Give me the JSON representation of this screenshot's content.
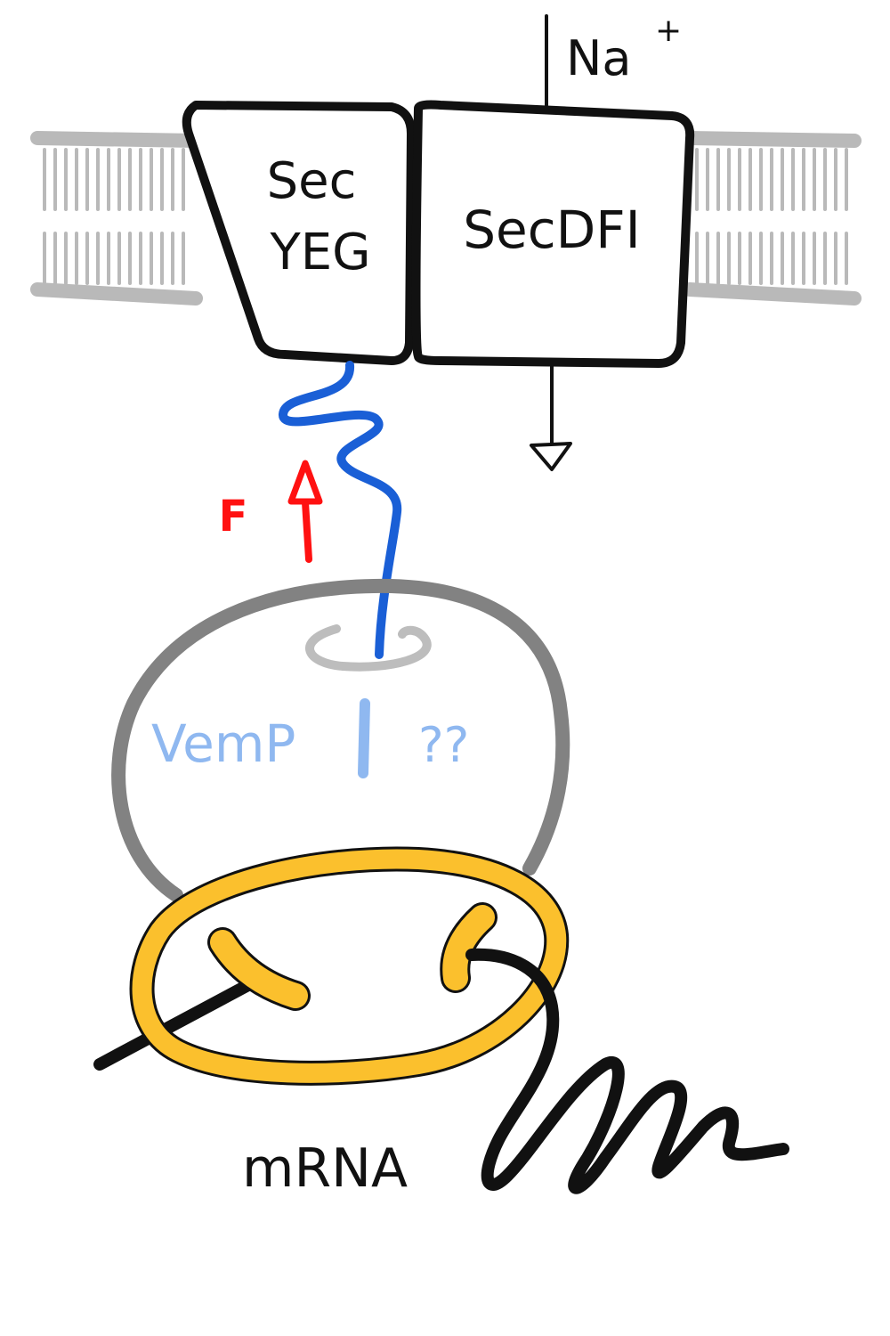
{
  "labels": {
    "secyeg_line1": "Sec",
    "secyeg_line2": "YEG",
    "secdfi": "SecDFI",
    "sodium": "Na",
    "sodium_charge": "+",
    "force": "F",
    "vemp": "VemP",
    "question": "??",
    "mrna": "mRNA"
  },
  "colors": {
    "membrane": "#b9b9b9",
    "outline": "#111111",
    "nascent_chain": "#1a5fd6",
    "force_arrow": "#ff1111",
    "vemp_text": "#8fb8f0",
    "ribosome_large": "#828282",
    "tunnel": "#bdbdbd",
    "ribosome_small": "#fbc02d"
  }
}
